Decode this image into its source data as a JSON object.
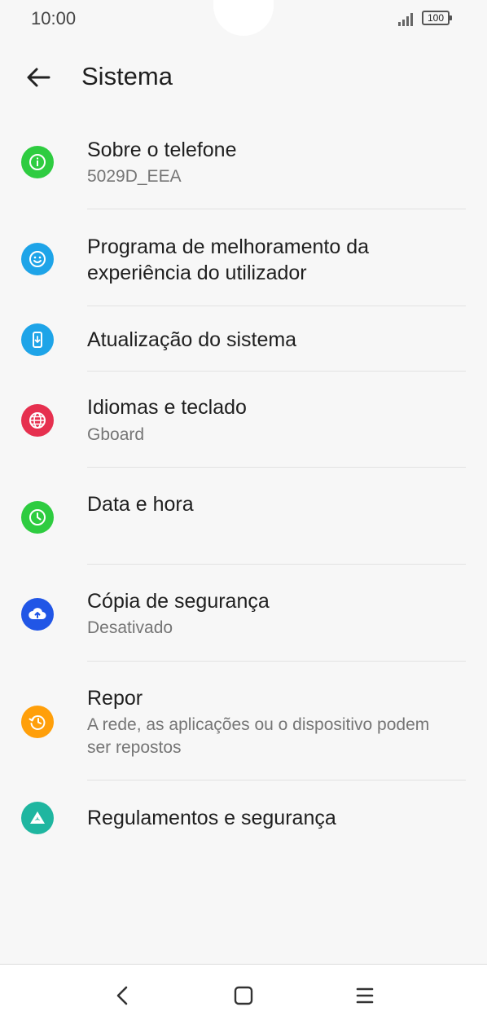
{
  "status": {
    "time": "10:00",
    "battery": "100"
  },
  "header": {
    "title": "Sistema"
  },
  "items": [
    {
      "title": "Sobre o telefone",
      "subtitle": "5029D_EEA",
      "icon": "info-icon",
      "color": "#2ecc40"
    },
    {
      "title": "Programa de melhoramento da experiência do utilizador",
      "subtitle": "",
      "icon": "smiley-icon",
      "color": "#1ea4e8"
    },
    {
      "title": "Atualização do sistema",
      "subtitle": "",
      "icon": "system-update-icon",
      "color": "#1ea4e8"
    },
    {
      "title": "Idiomas e teclado",
      "subtitle": "Gboard",
      "icon": "globe-icon",
      "color": "#e6304f"
    },
    {
      "title": "Data e hora",
      "subtitle": "",
      "icon": "clock-icon",
      "color": "#2ecc40"
    },
    {
      "title": "Cópia de segurança",
      "subtitle": "Desativado",
      "icon": "cloud-upload-icon",
      "color": "#2156e6"
    },
    {
      "title": "Repor",
      "subtitle": "A rede, as aplicações ou o dispositivo podem ser repostos",
      "icon": "restore-icon",
      "color": "#ff9f0a"
    },
    {
      "title": "Regulamentos e segurança",
      "subtitle": "",
      "icon": "regulatory-icon",
      "color": "#1fb6a0"
    }
  ]
}
